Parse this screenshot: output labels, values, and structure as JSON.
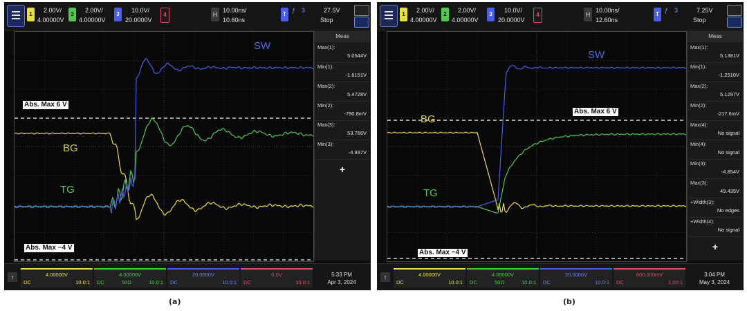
{
  "panels": [
    {
      "topbar": {
        "ch1_scale": "2.00V/",
        "ch1_offset": "4.00000V",
        "ch2_scale": "2.00V/",
        "ch2_offset": "4.00000V",
        "ch3_scale": "10.0V/",
        "ch3_offset": "20.0000V",
        "ch4_label": "4",
        "timebase": "10.00ns/",
        "delay": "10.60ns",
        "trig_ch": "3",
        "trig_level": "27.5V",
        "run_state": "Stop"
      },
      "meas_title": "Meas",
      "measurements": [
        {
          "label": "Max(1):",
          "value": "5.0544V"
        },
        {
          "label": "Min(1):",
          "value": "-1.6151V"
        },
        {
          "label": "Max(2):",
          "value": "5.4728V"
        },
        {
          "label": "Min(2):",
          "value": "-790.8mV"
        },
        {
          "label": "Max(3):",
          "value": "53.766V"
        },
        {
          "label": "Min(3):",
          "value": "-4.937V"
        }
      ],
      "add_button": "+",
      "bottom": [
        {
          "v": "4.00000V",
          "c": "DC",
          "o": "",
          "p": "10.0:1"
        },
        {
          "v": "4.00000V",
          "c": "DC",
          "o": "50Ω",
          "p": "10.0:1"
        },
        {
          "v": "20.0000V",
          "c": "DC",
          "o": "",
          "p": "10.0:1"
        },
        {
          "v": "0.0V",
          "c": "DC",
          "o": "",
          "p": "10.0:1"
        }
      ],
      "clock": {
        "time": "5:33 PM",
        "date": "Apr 3, 2024"
      },
      "labels": {
        "sw": "SW",
        "bg": "BG",
        "tg": "TG",
        "abs_max": "Abs. Max 6 V",
        "abs_min": "Abs. Max −4 V"
      },
      "caption": "(a)"
    },
    {
      "topbar": {
        "ch1_scale": "2.00V/",
        "ch1_offset": "4.00000V",
        "ch2_scale": "2.00V/",
        "ch2_offset": "4.00000V",
        "ch3_scale": "10.0V/",
        "ch3_offset": "20.0000V",
        "ch4_label": "4",
        "timebase": "10.00ns/",
        "delay": "12.60ns",
        "trig_ch": "3",
        "trig_level": "7.25V",
        "run_state": "Stop"
      },
      "meas_title": "Meas",
      "measurements": [
        {
          "label": "Max(1):",
          "value": "5.1381V"
        },
        {
          "label": "Min(1):",
          "value": "-1.2510V"
        },
        {
          "label": "Max(2):",
          "value": "5.1297V"
        },
        {
          "label": "Min(2):",
          "value": "-217.6mV"
        },
        {
          "label": "Max(4):",
          "value": "No signal"
        },
        {
          "label": "Min(4):",
          "value": "No signal"
        },
        {
          "label": "Min(3):",
          "value": "-4.854V"
        },
        {
          "label": "Max(3):",
          "value": "49.435V"
        },
        {
          "label": "+Width(3):",
          "value": "No edges"
        },
        {
          "label": "+Width(4):",
          "value": "No signal"
        }
      ],
      "add_button": "+",
      "bottom": [
        {
          "v": "4.00000V",
          "c": "DC",
          "o": "",
          "p": "10.0:1"
        },
        {
          "v": "4.00000V",
          "c": "DC",
          "o": "50Ω",
          "p": "10.0:1"
        },
        {
          "v": "20.0000V",
          "c": "DC",
          "o": "",
          "p": "10.0:1"
        },
        {
          "v": "600.000mV",
          "c": "DC",
          "o": "",
          "p": "1.00:1"
        }
      ],
      "clock": {
        "time": "3:04 PM",
        "date": "May 3, 2024"
      },
      "labels": {
        "sw": "SW",
        "bg": "BG",
        "tg": "TG",
        "abs_max": "Abs. Max 6 V",
        "abs_min": "Abs. Max −4 V"
      },
      "caption": "(b)"
    }
  ],
  "colors": {
    "ch1": "#e8e040",
    "ch2": "#4ec94e",
    "ch3": "#4a5ee8",
    "ch4": "#e84a6a",
    "sw_label": "#4a6ee0",
    "bg_label": "#d8d040",
    "tg_label": "#5cc45c"
  }
}
